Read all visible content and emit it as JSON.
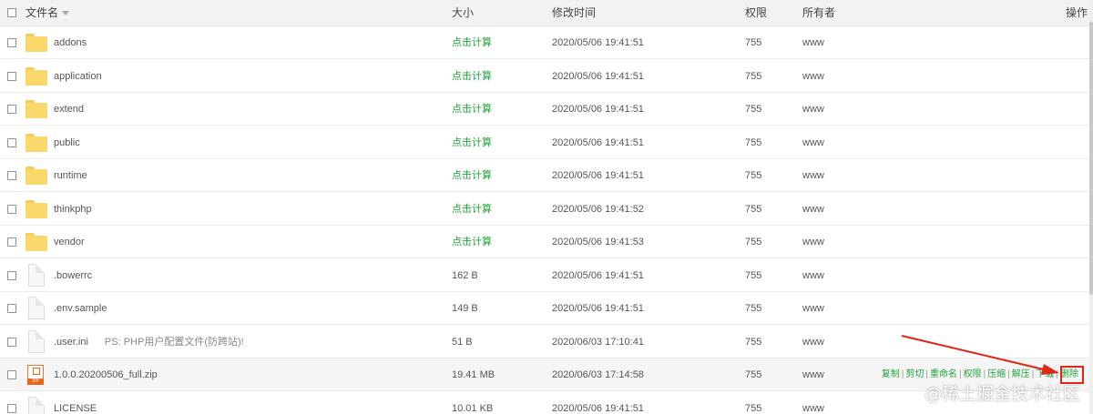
{
  "header": {
    "name_label": "文件名",
    "size_label": "大小",
    "modified_label": "修改时间",
    "perm_label": "权限",
    "owner_label": "所有者",
    "actions_label": "操作"
  },
  "rows": [
    {
      "name": "addons",
      "type": "folder",
      "size": "点击计算",
      "modified": "2020/05/06 19:41:51",
      "perm": "755",
      "owner": "www"
    },
    {
      "name": "application",
      "type": "folder",
      "size": "点击计算",
      "modified": "2020/05/06 19:41:51",
      "perm": "755",
      "owner": "www"
    },
    {
      "name": "extend",
      "type": "folder",
      "size": "点击计算",
      "modified": "2020/05/06 19:41:51",
      "perm": "755",
      "owner": "www"
    },
    {
      "name": "public",
      "type": "folder",
      "size": "点击计算",
      "modified": "2020/05/06 19:41:51",
      "perm": "755",
      "owner": "www"
    },
    {
      "name": "runtime",
      "type": "folder",
      "size": "点击计算",
      "modified": "2020/05/06 19:41:51",
      "perm": "755",
      "owner": "www"
    },
    {
      "name": "thinkphp",
      "type": "folder",
      "size": "点击计算",
      "modified": "2020/05/06 19:41:52",
      "perm": "755",
      "owner": "www"
    },
    {
      "name": "vendor",
      "type": "folder",
      "size": "点击计算",
      "modified": "2020/05/06 19:41:53",
      "perm": "755",
      "owner": "www"
    },
    {
      "name": ".bowerrc",
      "type": "file",
      "size": "162 B",
      "modified": "2020/05/06 19:41:51",
      "perm": "755",
      "owner": "www"
    },
    {
      "name": ".env.sample",
      "type": "file",
      "size": "149 B",
      "modified": "2020/05/06 19:41:51",
      "perm": "755",
      "owner": "www"
    },
    {
      "name": ".user.ini",
      "type": "file",
      "note": "PS: PHP用户配置文件(防跨站)!",
      "size": "51 B",
      "modified": "2020/06/03 17:10:41",
      "perm": "755",
      "owner": "www"
    },
    {
      "name": "1.0.0.20200506_full.zip",
      "type": "zip",
      "zip_label": "ZIP",
      "size": "19.41 MB",
      "modified": "2020/06/03 17:14:58",
      "perm": "755",
      "owner": "www"
    },
    {
      "name": "LICENSE",
      "type": "file",
      "size": "10.01 KB",
      "modified": "2020/05/06 19:41:51",
      "perm": "755",
      "owner": "www"
    }
  ],
  "row_actions": [
    "复制",
    "剪切",
    "重命名",
    "权限",
    "压缩",
    "解压",
    "下载",
    "删除"
  ],
  "accent_color": "#20a53a",
  "annotation_color": "#e2261b",
  "watermark": "@稀土掘金技术社区"
}
